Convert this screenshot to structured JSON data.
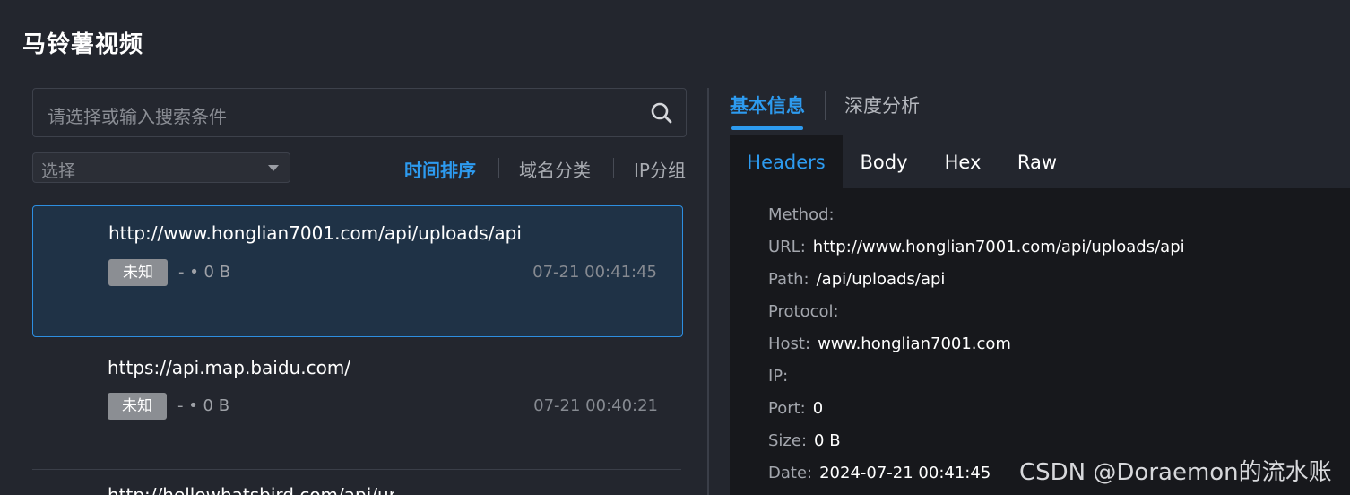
{
  "app": {
    "title": "马铃薯视频"
  },
  "search": {
    "placeholder": "请选择或输入搜索条件",
    "icon": "search-icon"
  },
  "filter": {
    "selected": "选择"
  },
  "sort_tabs": [
    {
      "label": "时间排序",
      "active": true
    },
    {
      "label": "域名分类",
      "active": false
    },
    {
      "label": "IP分组",
      "active": false
    }
  ],
  "requests": [
    {
      "url": "http://www.honglian7001.com/api/uploads/api",
      "badge": "未知",
      "meta": "- • 0 B",
      "time": "07-21 00:41:45",
      "selected": true
    },
    {
      "url": "https://api.map.baidu.com/",
      "badge": "未知",
      "meta": "- • 0 B",
      "time": "07-21 00:40:21",
      "selected": false
    },
    {
      "url": "http://hellowhatsbird.com/api/uploads/api",
      "partial": true
    }
  ],
  "info_tabs": [
    {
      "label": "基本信息",
      "active": true
    },
    {
      "label": "深度分析",
      "active": false
    }
  ],
  "sub_tabs": [
    {
      "label": "Headers",
      "active": true
    },
    {
      "label": "Body",
      "active": false
    },
    {
      "label": "Hex",
      "active": false
    },
    {
      "label": "Raw",
      "active": false
    }
  ],
  "details": [
    {
      "key": "Method:",
      "value": ""
    },
    {
      "key": "URL:",
      "value": "http://www.honglian7001.com/api/uploads/api"
    },
    {
      "key": "Path:",
      "value": "/api/uploads/api"
    },
    {
      "key": "Protocol:",
      "value": ""
    },
    {
      "key": "Host:",
      "value": "www.honglian7001.com"
    },
    {
      "key": "IP:",
      "value": ""
    },
    {
      "key": "Port:",
      "value": "0"
    },
    {
      "key": "Size:",
      "value": "0 B"
    },
    {
      "key": "Date:",
      "value": "2024-07-21 00:41:45"
    }
  ],
  "watermark": "CSDN @Doraemon的流水账",
  "colors": {
    "accent": "#2d9bf0",
    "background": "#23262e",
    "panel": "#17181c",
    "selected_item": "#1f3246"
  }
}
